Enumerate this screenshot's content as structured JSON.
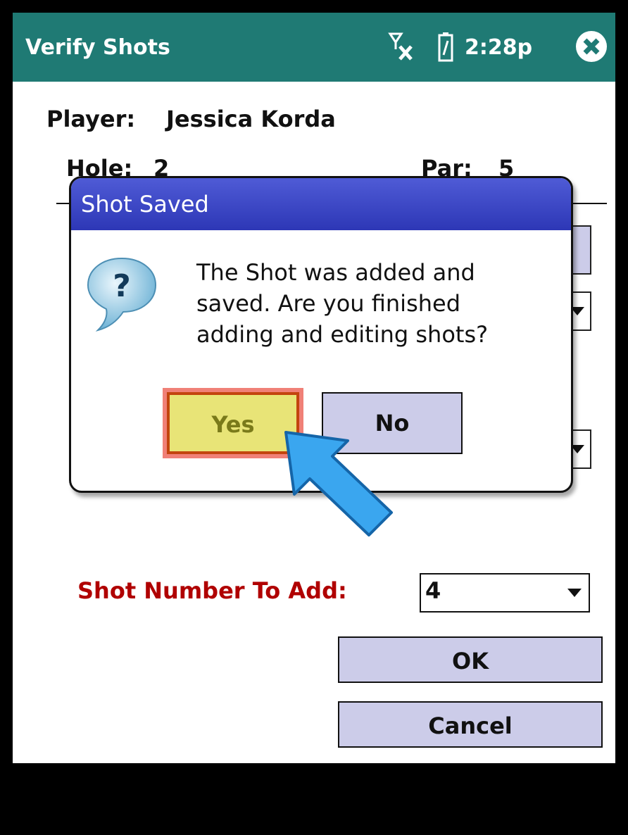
{
  "titlebar": {
    "title": "Verify Shots",
    "time": "2:28p",
    "signal_icon": "signal-off-icon",
    "battery_icon": "battery-icon",
    "close_icon": "close-icon"
  },
  "info": {
    "player_label": "Player:",
    "player_name": "Jessica Korda",
    "hole_label": "Hole:",
    "hole_value": "2",
    "par_label": "Par:",
    "par_value": "5"
  },
  "form": {
    "shot_label": "Shot Number To Add:",
    "shot_value": "4",
    "ok_label": "OK",
    "cancel_label": "Cancel"
  },
  "dialog": {
    "title": "Shot Saved",
    "message_lines": [
      "The Shot was added and",
      "saved. Are you finished",
      "adding and editing shots?"
    ],
    "yes_label": "Yes",
    "no_label": "No",
    "icon": "question-icon"
  },
  "colors": {
    "titlebar": "#1f7a74",
    "dialog_header": "#3a45c4",
    "button_bg": "#cccce9",
    "highlight": "#e8e477",
    "shot_label": "#b00000"
  }
}
